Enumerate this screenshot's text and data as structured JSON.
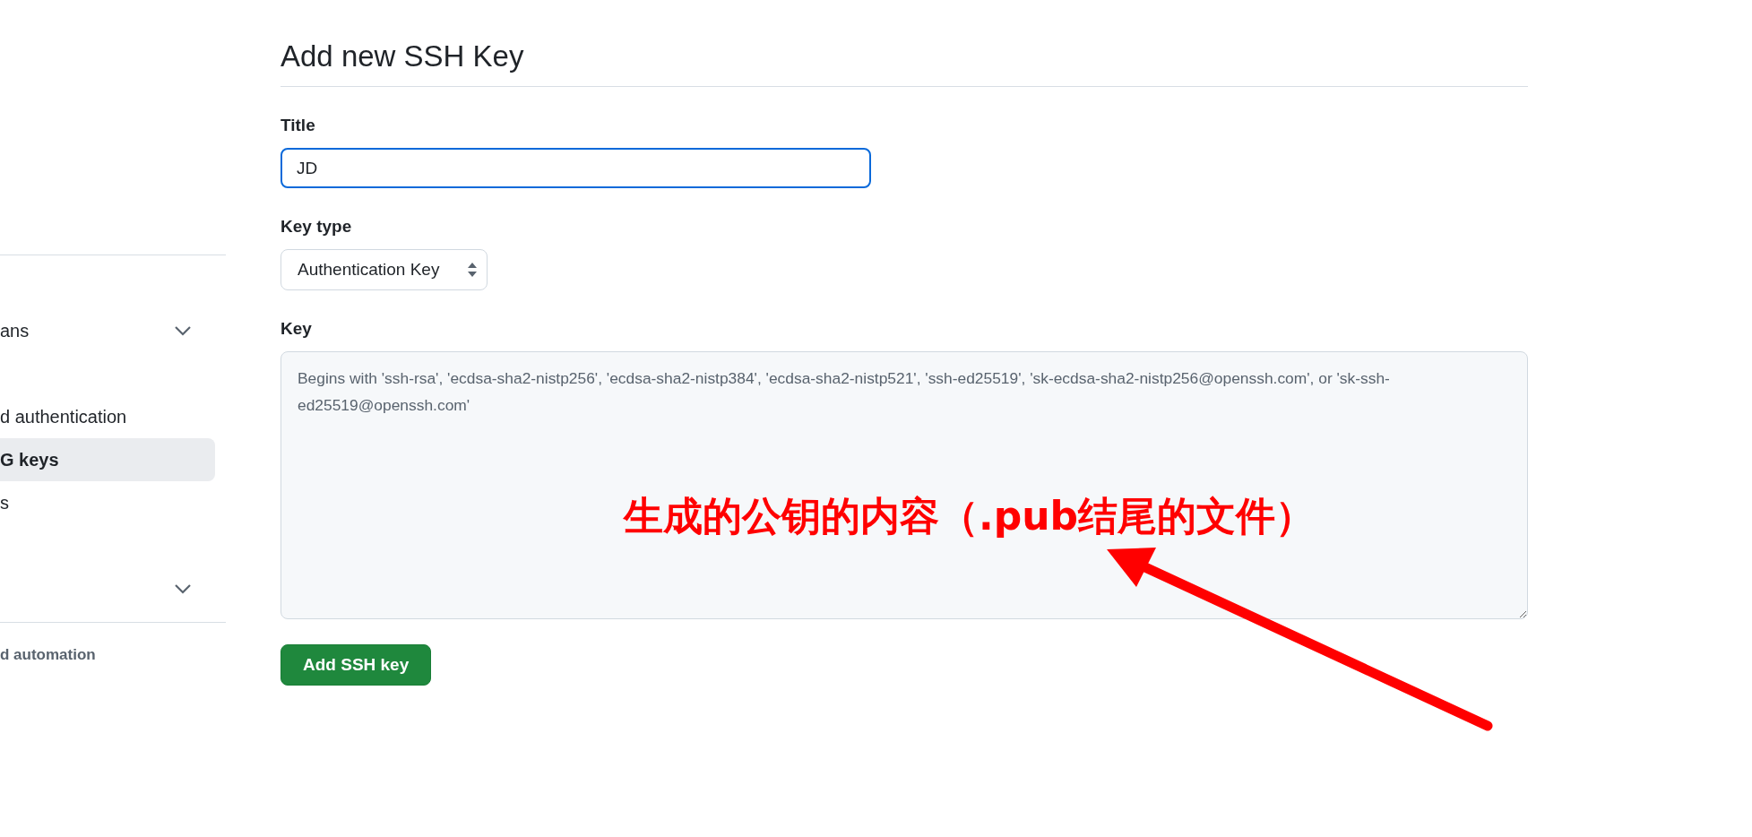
{
  "sidebar": {
    "items": [
      {
        "kind": "group",
        "label": "ans",
        "expanded": false
      },
      {
        "kind": "link",
        "label": "d authentication",
        "selected": false
      },
      {
        "kind": "link",
        "label": "G keys",
        "selected": true
      },
      {
        "kind": "link",
        "label": "s",
        "selected": false
      },
      {
        "kind": "group",
        "expanded": false
      }
    ],
    "section_heading": "d automation"
  },
  "form": {
    "heading": "Add new SSH Key",
    "title_field": {
      "label": "Title",
      "value": "JD"
    },
    "key_type": {
      "label": "Key type",
      "value": "Authentication Key"
    },
    "key_field": {
      "label": "Key",
      "placeholder": "Begins with 'ssh-rsa', 'ecdsa-sha2-nistp256', 'ecdsa-sha2-nistp384', 'ecdsa-sha2-nistp521', 'ssh-ed25519', 'sk-ecdsa-sha2-nistp256@openssh.com', or 'sk-ssh-ed25519@openssh.com'"
    },
    "submit": "Add SSH key"
  },
  "annotation": {
    "text": "生成的公钥的内容（.pub结尾的文件）"
  }
}
